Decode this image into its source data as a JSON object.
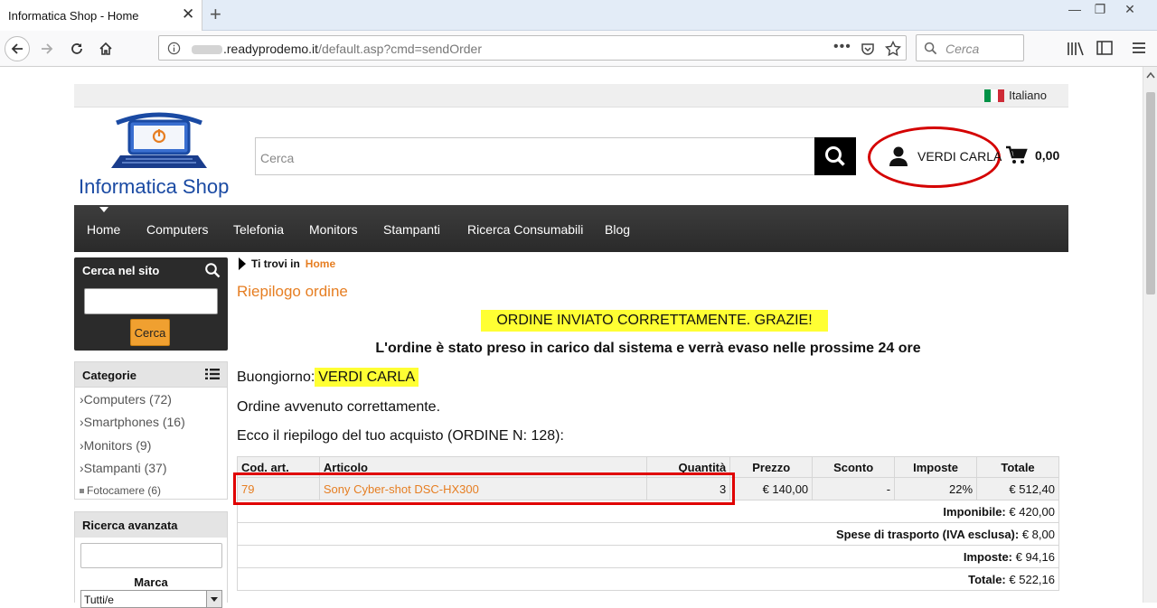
{
  "browser": {
    "tab_title": "Informatica Shop - Home",
    "url_host": ".readyprodemo.it",
    "url_path": "/default.asp?cmd=sendOrder",
    "search_placeholder": "Cerca"
  },
  "header": {
    "language": "Italiano",
    "logo_text": "Informatica Shop",
    "search_placeholder": "Cerca",
    "user_name": "VERDI CARLA",
    "cart_total": "0,00"
  },
  "menu": {
    "items": [
      "Home",
      "Computers",
      "Telefonia",
      "Monitors",
      "Stampanti",
      "Ricerca Consumabili",
      "Blog"
    ]
  },
  "sidebar": {
    "search_title": "Cerca nel sito",
    "search_button": "Cerca",
    "categories_title": "Categorie",
    "categories": [
      {
        "label": "Computers (72)"
      },
      {
        "label": "Smartphones (16)"
      },
      {
        "label": "Monitors (9)"
      },
      {
        "label": "Stampanti (37)"
      },
      {
        "label": "Fotocamere (6)"
      }
    ],
    "advanced_title": "Ricerca avanzata",
    "brand_label": "Marca",
    "brand_selected": "Tutti/e"
  },
  "main": {
    "breadcrumb_prefix": "Ti trovi in",
    "breadcrumb_home": "Home",
    "title": "Riepilogo ordine",
    "success_banner": "ORDINE INVIATO CORRETTAMENTE. GRAZIE!",
    "notice": "L'ordine è stato preso in carico dal sistema e verrà evaso nelle prossime 24 ore",
    "greeting": "Buongiorno:",
    "greeting_name": "VERDI CARLA",
    "confirm": "Ordine avvenuto correttamente.",
    "summary": "Ecco il riepilogo del tuo acquisto (ORDINE N: 128):"
  },
  "order": {
    "headers": [
      "Cod. art.",
      "Articolo",
      "Quantità",
      "Prezzo",
      "Sconto",
      "Imposte",
      "Totale"
    ],
    "item": {
      "code": "79",
      "name": "Sony Cyber-shot DSC-HX300",
      "qty": "3",
      "price": "€ 140,00",
      "discount": "-",
      "tax": "22%",
      "total": "€ 512,40"
    },
    "imponibile_label": "Imponibile:",
    "imponibile_value": "€ 420,00",
    "shipping_label": "Spese di trasporto (IVA esclusa):",
    "shipping_value": "€ 8,00",
    "tax_label": "Imposte:",
    "tax_value": "€ 94,16",
    "total_label": "Totale:",
    "total_value": "€ 522,16"
  }
}
